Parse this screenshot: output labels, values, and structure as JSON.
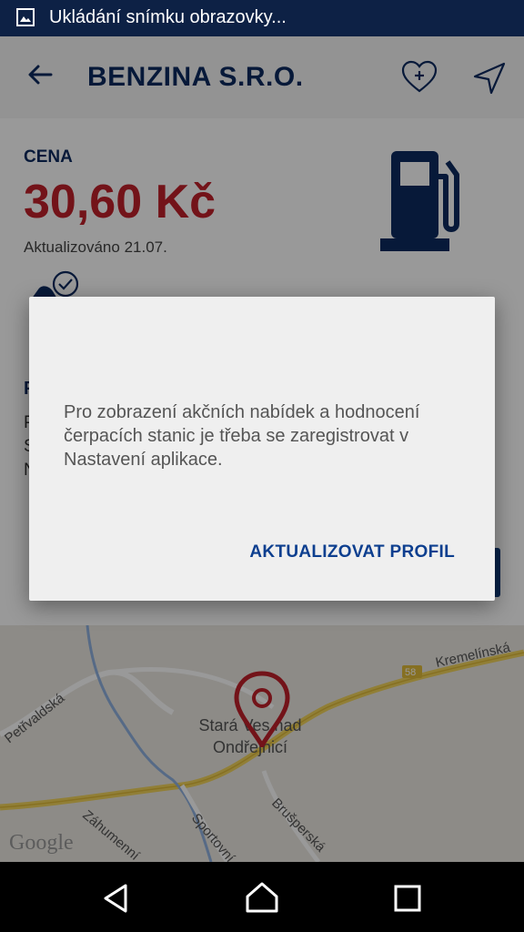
{
  "status_bar": {
    "notification_text": "Ukládání snímku obrazovky..."
  },
  "app_bar": {
    "title": "BENZINA S.R.O."
  },
  "price_card": {
    "label": "CENA",
    "price": "30,60 Kč",
    "updated": "Aktualizováno 21.07."
  },
  "map": {
    "labels": [
      "Kremelínská",
      "Petřvaldská",
      "Stará Ves nad Ondřejnicí",
      "Záhumenní",
      "Sportovní",
      "Brušperská"
    ],
    "road_number": "58",
    "watermark": "Google"
  },
  "dialog": {
    "message": "Pro zobrazení akčních nabídek a hodnocení čerpacích stanic je třeba se zaregistrovat v Nastavení aplikace.",
    "action_label": "AKTUALIZOVAT PROFIL"
  },
  "colors": {
    "brand_blue": "#0d2a5f",
    "price_red": "#c0202a",
    "status_bar": "#0d2145"
  }
}
